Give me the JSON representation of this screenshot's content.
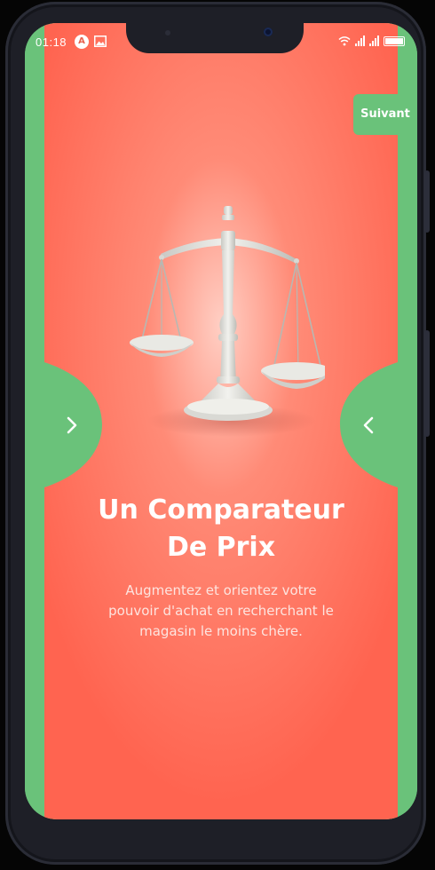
{
  "status_bar": {
    "time": "01:18",
    "app_icon_letter": "A",
    "icons": [
      "app-notification-icon",
      "image-icon",
      "wifi-icon",
      "signal-icon",
      "signal-icon",
      "battery-icon"
    ]
  },
  "onboarding": {
    "skip_label": "Suivant",
    "title_line1": "Un Comparateur",
    "title_line2": "De Prix",
    "description_line1": "Augmentez et orientez votre",
    "description_line2": "pouvoir d'achat en recherchant le",
    "description_line3": "magasin le moins chère.",
    "illustration": "balance-scale-icon",
    "next_arrow": "chevron-right-icon",
    "prev_arrow": "chevron-left-icon"
  },
  "colors": {
    "slide_primary": "#ff6b57",
    "slide_highlight": "#ffc9bd",
    "slide_secondary": "#6ac27a",
    "text": "#ffffff"
  }
}
